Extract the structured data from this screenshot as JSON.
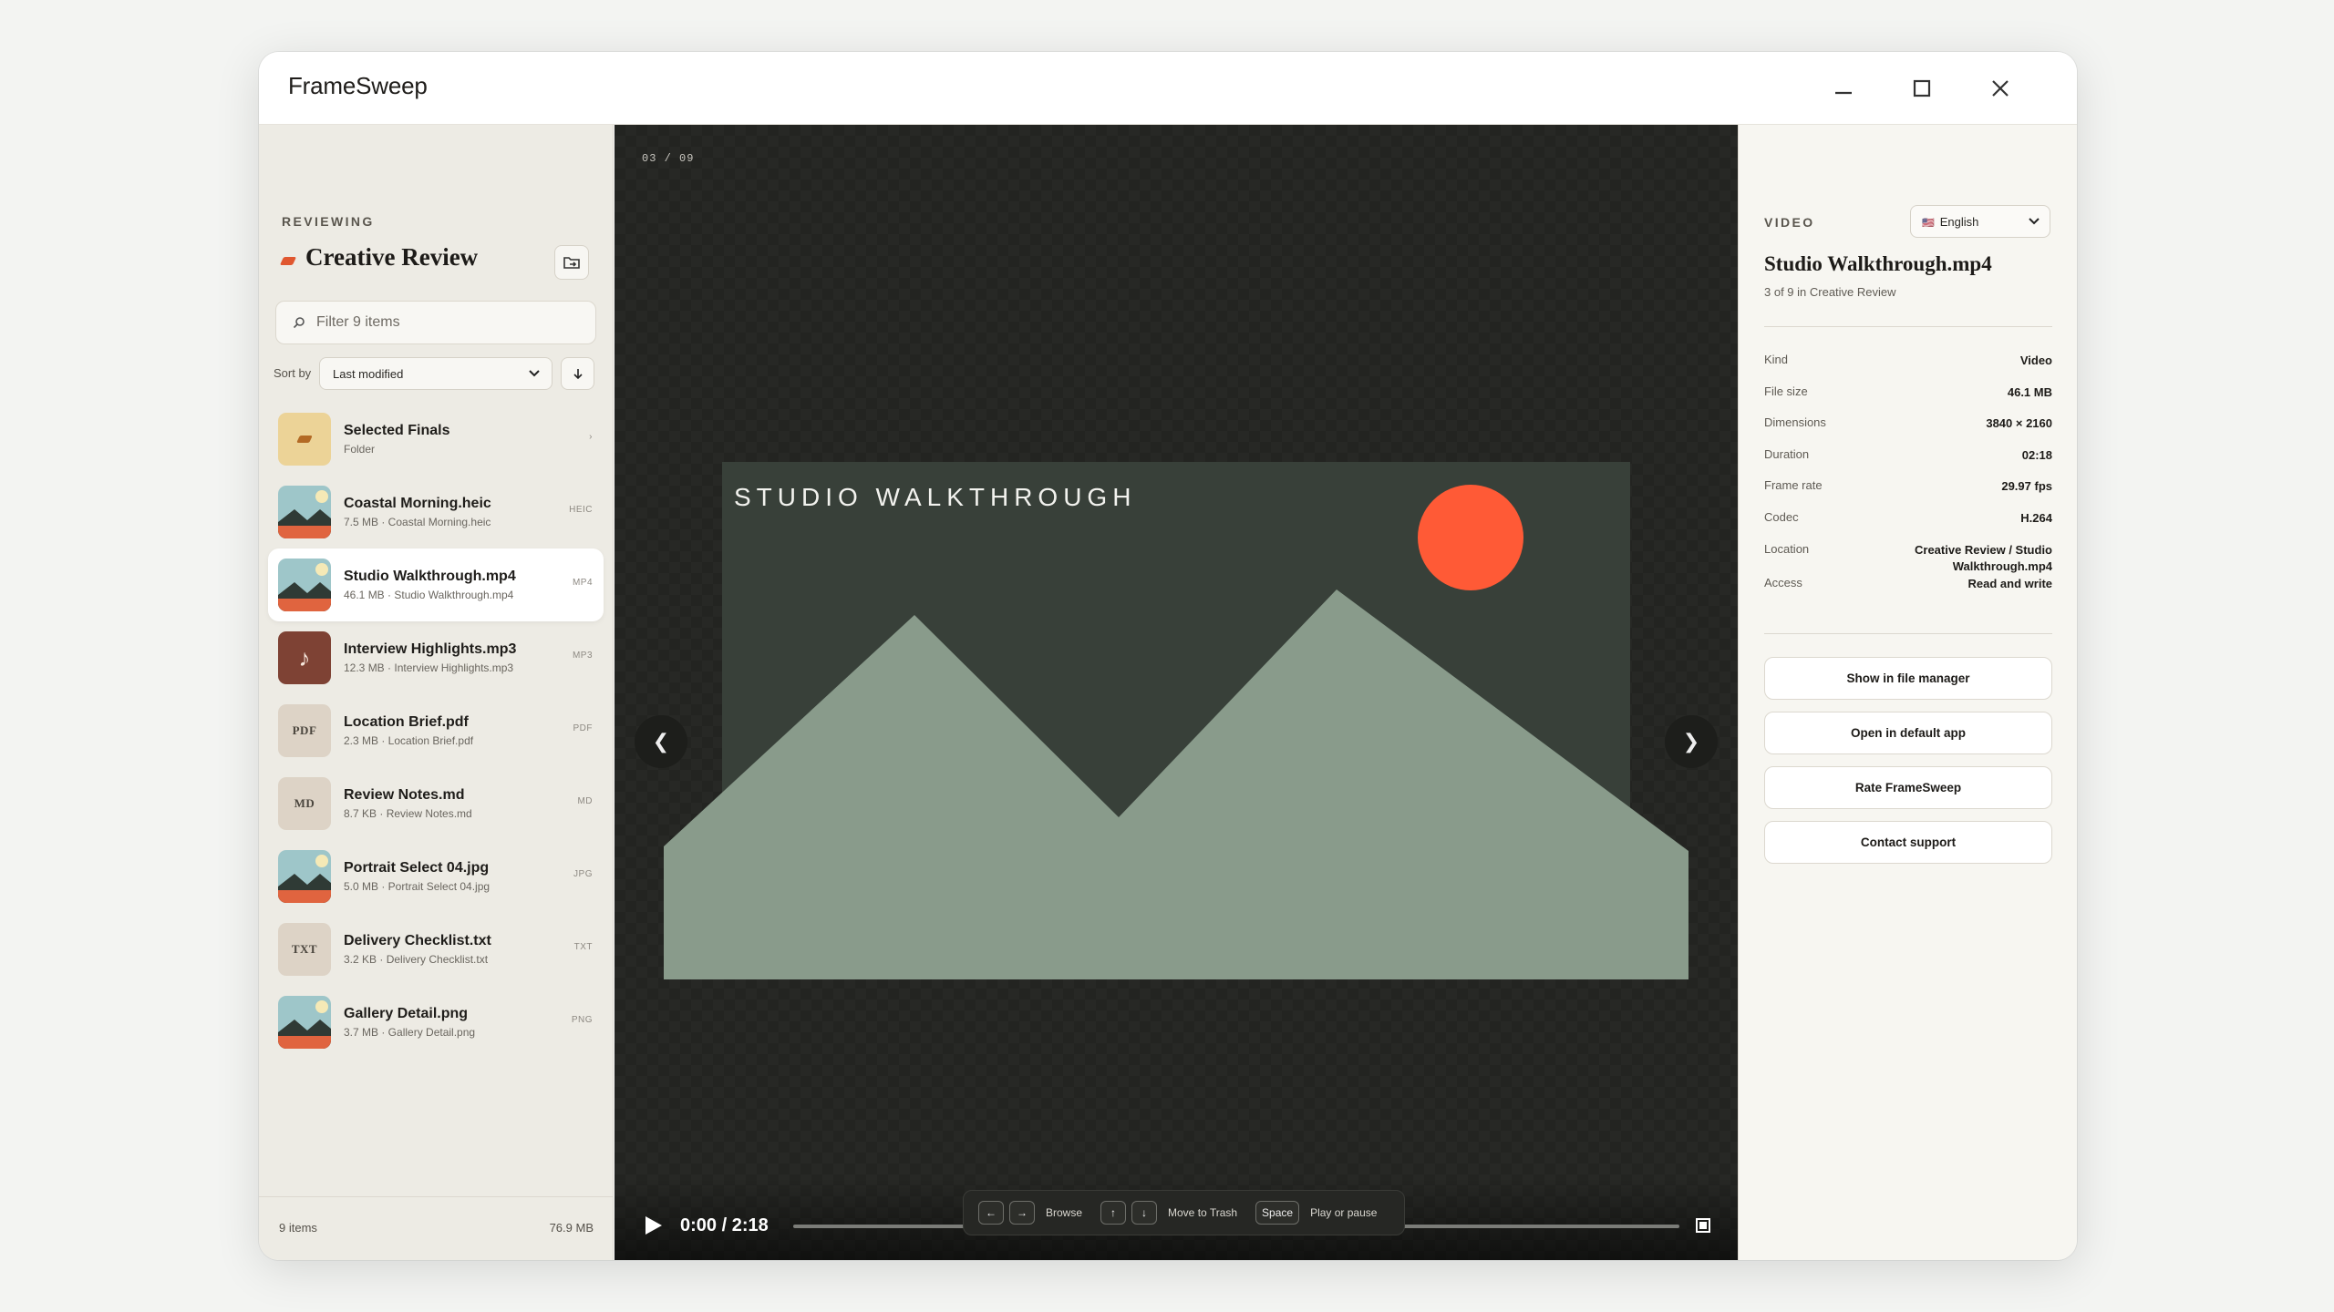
{
  "window": {
    "title": "FrameSweep"
  },
  "sidebar": {
    "eyebrow": "REVIEWING",
    "collection_title": "Creative Review",
    "filter_placeholder": "Filter 9 items",
    "sort_label": "Sort by",
    "sort_value": "Last modified",
    "items": [
      {
        "name": "Selected Finals",
        "meta": "Folder",
        "ext": "›",
        "kind": "folder",
        "selected": false
      },
      {
        "name": "Coastal Morning.heic",
        "meta": "7.5 MB · Coastal Morning.heic",
        "ext": "HEIC",
        "kind": "image",
        "selected": false
      },
      {
        "name": "Studio Walkthrough.mp4",
        "meta": "46.1 MB · Studio Walkthrough.mp4",
        "ext": "MP4",
        "kind": "image",
        "selected": true
      },
      {
        "name": "Interview Highlights.mp3",
        "meta": "12.3 MB · Interview Highlights.mp3",
        "ext": "MP3",
        "kind": "audio",
        "selected": false
      },
      {
        "name": "Location Brief.pdf",
        "meta": "2.3 MB · Location Brief.pdf",
        "ext": "PDF",
        "kind": "doc",
        "badge": "PDF",
        "selected": false
      },
      {
        "name": "Review Notes.md",
        "meta": "8.7 KB · Review Notes.md",
        "ext": "MD",
        "kind": "doc",
        "badge": "MD",
        "selected": false
      },
      {
        "name": "Portrait Select 04.jpg",
        "meta": "5.0 MB · Portrait Select 04.jpg",
        "ext": "JPG",
        "kind": "image",
        "selected": false
      },
      {
        "name": "Delivery Checklist.txt",
        "meta": "3.2 KB · Delivery Checklist.txt",
        "ext": "TXT",
        "kind": "doc",
        "badge": "TXT",
        "selected": false
      },
      {
        "name": "Gallery Detail.png",
        "meta": "3.7 MB · Gallery Detail.png",
        "ext": "PNG",
        "kind": "image",
        "selected": false
      }
    ],
    "footer_count": "9 items",
    "footer_size": "76.9 MB"
  },
  "viewer": {
    "counter": "03 / 09",
    "video_title": "STUDIO WALKTHROUGH",
    "time": "0:00 / 2:18",
    "progress": 0.0,
    "shortcuts": [
      {
        "keys": [
          "←",
          "→"
        ],
        "label": "Browse"
      },
      {
        "keys": [
          "↑",
          "↓"
        ],
        "label": "Move to Trash"
      },
      {
        "keys": [
          "Space"
        ],
        "label": "Play or pause"
      }
    ]
  },
  "inspector": {
    "eyebrow": "VIDEO",
    "language": "English",
    "language_flag": "🇺🇸",
    "title": "Studio Walkthrough.mp4",
    "subtitle": "3 of 9 in Creative Review",
    "properties": [
      {
        "key": "Kind",
        "value": "Video"
      },
      {
        "key": "File size",
        "value": "46.1 MB"
      },
      {
        "key": "Dimensions",
        "value": "3840 × 2160"
      },
      {
        "key": "Duration",
        "value": "02:18"
      },
      {
        "key": "Frame rate",
        "value": "29.97 fps"
      },
      {
        "key": "Codec",
        "value": "H.264"
      },
      {
        "key": "Location",
        "value": "Creative Review / Studio Walkthrough.mp4"
      },
      {
        "key": "Access",
        "value": "Read and write"
      }
    ],
    "actions": [
      "Show in file manager",
      "Open in default app",
      "Rate FrameSweep",
      "Contact support"
    ]
  },
  "colors": {
    "accent": "#e0572f",
    "sun": "#ff5a36",
    "mountain": "#899b8b",
    "video_bg": "#384039",
    "folder_thumb": "#ecd397",
    "audio_thumb": "#7e4234"
  }
}
